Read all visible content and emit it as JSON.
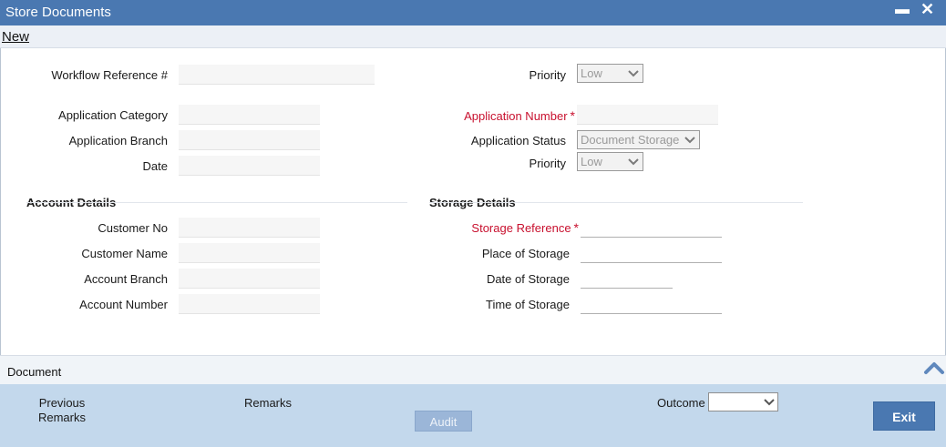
{
  "window": {
    "title": "Store Documents",
    "minimize_glyph": "▬",
    "close_glyph": "✕"
  },
  "toolbar": {
    "new_label": "New"
  },
  "top": {
    "workflow_ref_label": "Workflow Reference #",
    "priority_label": "Priority",
    "priority_value": "Low"
  },
  "application": {
    "category_label": "Application Category",
    "branch_label": "Application Branch",
    "date_label": "Date",
    "number_label": "Application Number",
    "status_label": "Application Status",
    "status_value": "Document Storage",
    "priority_label": "Priority",
    "priority_value": "Low"
  },
  "account": {
    "section_title": "Account Details",
    "customer_no_label": "Customer No",
    "customer_name_label": "Customer Name",
    "account_branch_label": "Account Branch",
    "account_number_label": "Account Number"
  },
  "storage": {
    "section_title": "Storage Details",
    "reference_label": "Storage Reference",
    "place_label": "Place of Storage",
    "date_label": "Date of Storage",
    "time_label": "Time of Storage"
  },
  "required_marker": "*",
  "document_bar": {
    "label": "Document",
    "icon": "chevron-up-icon"
  },
  "footer": {
    "previous_remarks_line1": "Previous",
    "previous_remarks_line2": "Remarks",
    "remarks_label": "Remarks",
    "audit_label": "Audit",
    "outcome_label": "Outcome",
    "exit_label": "Exit"
  },
  "colors": {
    "title_bar": "#4a78b1",
    "required_text": "#c8102e",
    "footer_bg": "#c3d8ec",
    "exit_button": "#4a78b1"
  }
}
